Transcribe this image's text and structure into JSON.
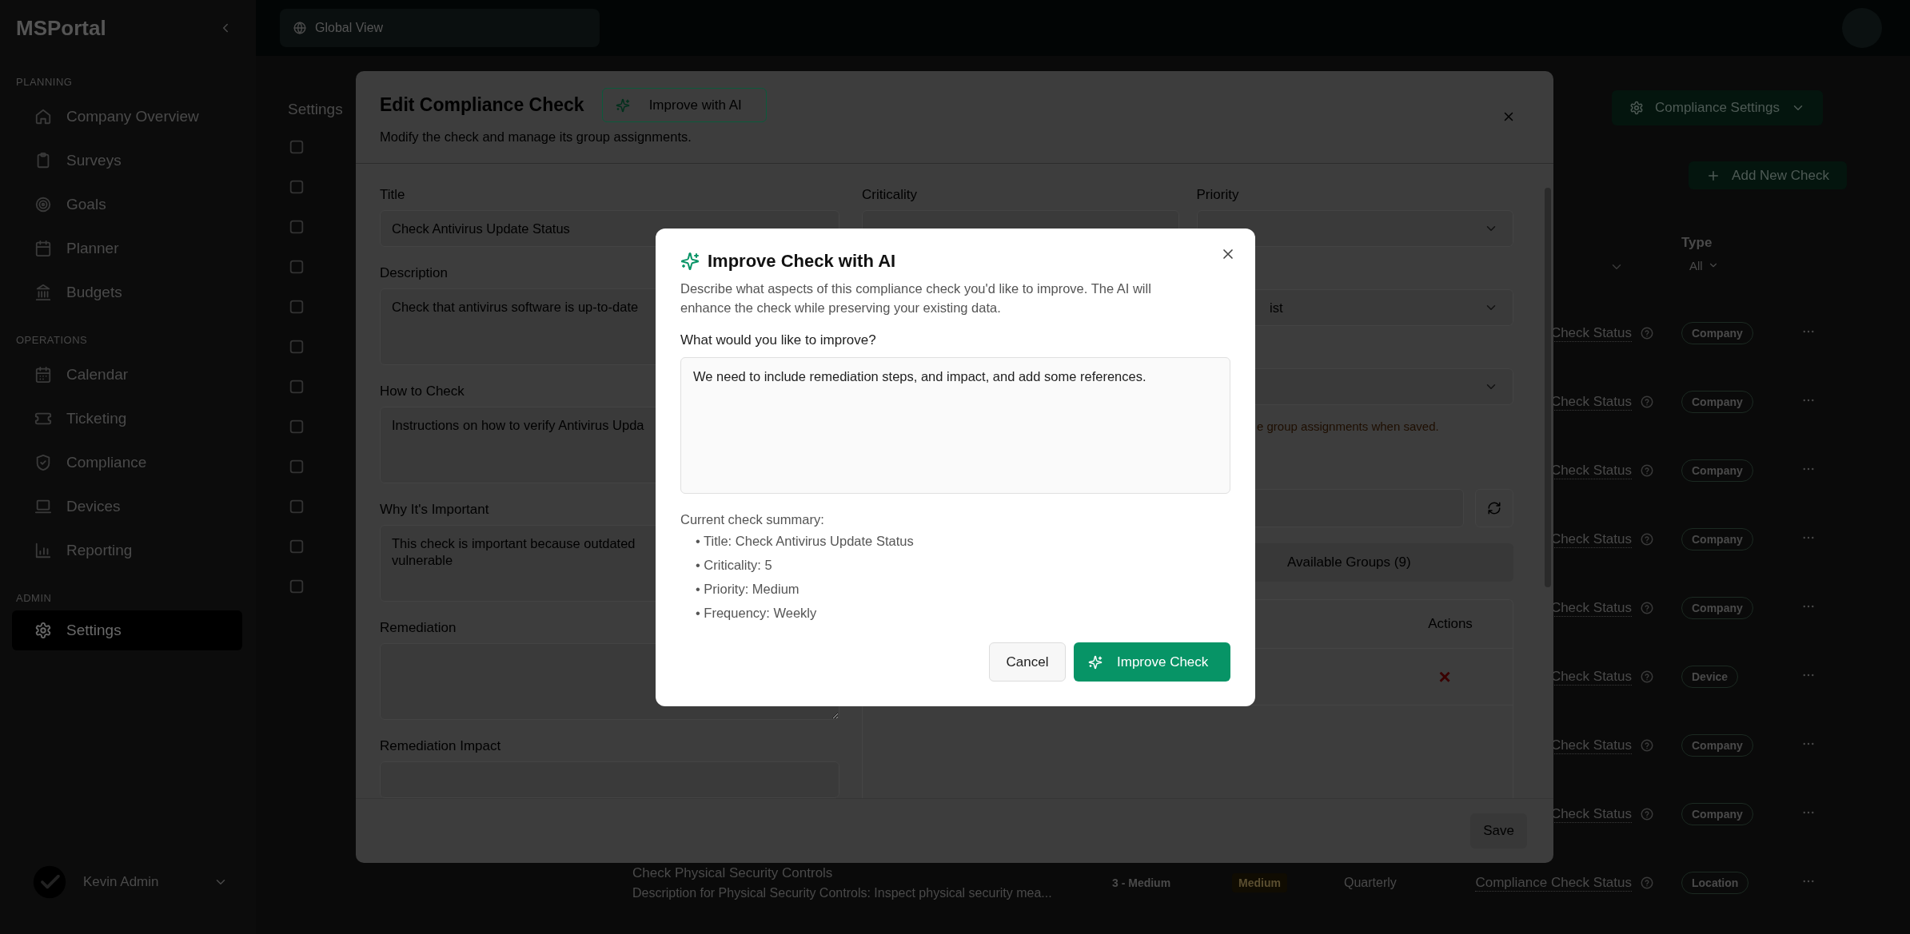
{
  "sidebar": {
    "brand": "MSPortal",
    "sections": [
      {
        "title": "PLANNING",
        "items": [
          {
            "label": "Company Overview",
            "selected": false
          },
          {
            "label": "Surveys",
            "selected": false
          },
          {
            "label": "Goals",
            "selected": false
          },
          {
            "label": "Planner",
            "selected": false
          },
          {
            "label": "Budgets",
            "selected": false
          }
        ]
      },
      {
        "title": "OPERATIONS",
        "items": [
          {
            "label": "Calendar",
            "selected": false
          },
          {
            "label": "Ticketing",
            "selected": false
          },
          {
            "label": "Compliance",
            "selected": false
          },
          {
            "label": "Devices",
            "selected": false
          },
          {
            "label": "Reporting",
            "selected": false
          }
        ]
      },
      {
        "title": "ADMIN",
        "items": [
          {
            "label": "Settings",
            "selected": true
          }
        ]
      }
    ],
    "user": {
      "name": "Kevin Admin"
    }
  },
  "topbar": {
    "search": {
      "placeholder": "Global View"
    }
  },
  "settings_nav": {
    "title": "Settings"
  },
  "page_actions": [
    {
      "label": "Compliance Settings",
      "kind": "menu"
    },
    {
      "label": "Add New Check",
      "kind": "add"
    }
  ],
  "checks_table": {
    "columns": [
      {
        "label": "Type",
        "filter": "All"
      }
    ],
    "rows": [
      {
        "status": "Check Status",
        "type": "Company"
      },
      {
        "status": "Check Status",
        "type": "Company"
      },
      {
        "status": "Check Status",
        "type": "Company"
      },
      {
        "status": "Check Status",
        "type": "Company"
      },
      {
        "status": "Check Status",
        "type": "Company"
      },
      {
        "status": "Check Status",
        "type": "Device"
      },
      {
        "status": "Check Status",
        "type": "Company"
      },
      {
        "status": "Check Status",
        "type": "Company"
      },
      {
        "title": "Check Physical Security Controls",
        "description": "Description for Physical Security Controls: Inspect physical security mea...",
        "criticality": "3 - Medium",
        "priority": "Medium",
        "frequency": "Quarterly",
        "status": "Compliance Check Status",
        "type": "Location"
      }
    ]
  },
  "edit_dialog": {
    "title": "Edit Compliance Check",
    "ai_button": "Improve with AI",
    "subtitle": "Modify the check and manage its group assignments.",
    "fields": [
      {
        "label": "Title",
        "kind": "input",
        "value": "Check Antivirus Update Status"
      },
      {
        "label": "Description",
        "kind": "textarea",
        "value": "Check that antivirus software is up-to-date"
      },
      {
        "label": "How to Check",
        "kind": "textarea",
        "value": "Instructions on how to verify Antivirus Upda"
      },
      {
        "label": "Why It's Important",
        "kind": "textarea",
        "value": "This check is important because outdated\nvulnerable"
      },
      {
        "label": "Remediation",
        "kind": "textarea"
      },
      {
        "label": "Remediation Impact",
        "kind": "input"
      }
    ],
    "selects": [
      {
        "label": "Criticality",
        "wide": false
      },
      {
        "label": "Priority",
        "wide": false
      },
      {
        "value": "ist",
        "wide": true
      },
      {
        "wide": true
      }
    ],
    "warning": "e group assignments when saved.",
    "group_tabs": [
      {
        "label": "Available Groups (9)",
        "selected": false
      }
    ],
    "groups_table": {
      "columns": [
        "Actions"
      ],
      "rows": [
        {
          "remove": "×"
        }
      ]
    },
    "save_button": "Save"
  },
  "ai_dialog": {
    "title": "Improve Check with AI",
    "description": "Describe what aspects of this compliance check you'd like to improve. The AI will enhance the check while preserving your existing data.",
    "prompt_label": "What would you like to improve?",
    "prompt_value": "We need to include remediation steps, and impact, and add some references.",
    "summary_title": "Current check summary:",
    "summary": [
      "• Title: Check Antivirus Update Status",
      "• Criticality: 5",
      "• Priority: Medium",
      "• Frequency: Weekly"
    ],
    "buttons": [
      {
        "label": "Cancel",
        "kind": "secondary"
      },
      {
        "label": "Improve Check",
        "kind": "primary"
      }
    ]
  }
}
